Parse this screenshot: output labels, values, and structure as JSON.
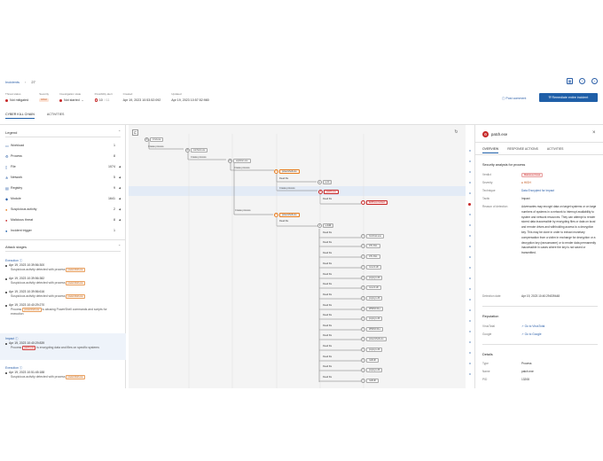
{
  "header": {
    "breadcrumb_root": "Incidents",
    "breadcrumb_id": "27",
    "status_label": "Threat status",
    "status_value": "Not mitigated",
    "severity_label": "Severity",
    "severity_value": "HIGH",
    "investigation_label": "Investigation state",
    "investigation_value": "Not started",
    "possibility_label": "Possibility alert",
    "possibility_value": "10",
    "possibility_total": "/ 11",
    "created_label": "Created",
    "created_value": "Apr 19, 2023 10:53:52:092",
    "updated_label": "Updated",
    "updated_value": "Apr 19, 2023 10:57:52:980",
    "post_comment": "Post comment",
    "remediate": "Remediate entire incident"
  },
  "tabs": [
    "CYBER KILL CHAIN",
    "ACTIVITIES"
  ],
  "legend": {
    "title": "Legend",
    "items": [
      {
        "name": "Workload",
        "count": "1",
        "icon": "workload-icon",
        "arrow": ""
      },
      {
        "name": "Process",
        "count": "8",
        "icon": "process-icon",
        "arrow": ""
      },
      {
        "name": "File",
        "count": "1074",
        "icon": "file-icon",
        "arrow": "◀"
      },
      {
        "name": "Network",
        "count": "5",
        "icon": "network-icon",
        "arrow": "◀"
      },
      {
        "name": "Registry",
        "count": "9",
        "icon": "registry-icon",
        "arrow": "◀"
      },
      {
        "name": "Module",
        "count": "1641",
        "icon": "module-icon",
        "arrow": "◀"
      },
      {
        "name": "Suspicious activity",
        "count": "2",
        "icon": "suspicious-icon",
        "arrow": "◀"
      },
      {
        "name": "Malicious threat",
        "count": "8",
        "icon": "malicious-icon",
        "arrow": "◀"
      },
      {
        "name": "Incident trigger",
        "count": "1",
        "icon": "trigger-icon",
        "arrow": ""
      }
    ]
  },
  "attack": {
    "title": "Attack stages",
    "stages": [
      {
        "name": "Execution",
        "items": [
          {
            "ts": "Apr 19, 2023 10:39:56:300",
            "desc": "Suspicious activity detected with process",
            "tag": "powershell.exe"
          },
          {
            "ts": "Apr 19, 2023 10:39:56:382",
            "desc": "Suspicious activity detected with process",
            "tag": "powershell.exe"
          },
          {
            "ts": "Apr 19, 2023 10:39:56:616",
            "desc": "Suspicious activity detected with process",
            "tag": "powershell.exe"
          },
          {
            "ts": "Apr 19, 2023 10:40:29:270",
            "desc_a": "Process",
            "tag": "powershell.exe",
            "desc_b": "is abusing PowerShell commands and scripts for execution"
          }
        ]
      },
      {
        "name": "Impact",
        "items": [
          {
            "ts": "Apr 19, 2023 10:40:29:839",
            "desc_a": "Process",
            "tag": "patch.exe",
            "desc_b": "is encrypting data and files on specific systems"
          }
        ]
      },
      {
        "name": "Execution",
        "items": [
          {
            "ts": "Apr 19, 2023 10:51:45:188",
            "desc": "Suspicious activity detected with process",
            "tag": "powershell.exe"
          }
        ]
      }
    ]
  },
  "graph": {
    "nodes": {
      "n1": "cmd.exe",
      "n2": "conhost.exe",
      "n3": "explorer.exe",
      "n4": "powershell.exe",
      "n5": "+ 4",
      "n6": "patch.exe",
      "n7": "EMP.exe.locked",
      "n8": "powershell.exe",
      "n9": "+ 110"
    },
    "edges": {
      "create_process": "Create process",
      "read_file": "Read file"
    },
    "files": [
      "Conhost.exe",
      "ATL.DLL",
      "ATL.DLL",
      "msvcrt.dll",
      "propsys.dll",
      "msvcrt.dll",
      "propsys.dll",
      "WMI32.DLL",
      "propsys.dll",
      "WMI32.DLL",
      "powershell.exe",
      "propsys.dll",
      "ntdll.dll",
      "propsys.dll",
      "ntdll.dll"
    ]
  },
  "detail": {
    "title": "patch.exe",
    "tabs": [
      "OVERVIEW",
      "RESPONSE ACTIONS",
      "ACTIVITIES"
    ],
    "security_title": "Security analysis for process",
    "verdict_label": "Verdict",
    "verdict_value": "Malicious threat",
    "severity_label": "Severity",
    "severity_value": "HIGH",
    "technique_label": "Technique",
    "technique_value": "Data Encrypted for Impact",
    "tactic_label": "Tactic",
    "tactic_value": "Impact",
    "reason_label": "Reason of detection",
    "reason_value": "Adversaries may encrypt data on target systems or on large numbers of systems in a network to interrupt availability to system and network resources. They can attempt to render stored data inaccessible by encrypting files or data on local and remote drives and withholding access to a decryption key. This may be done in order to extract monetary compensation from a victim in exchange for decryption or a decryption key (ransomware) or to render data permanently inaccessible in cases where the key is not saved or transmitted.",
    "detection_label": "Detection date",
    "detection_value": "Apr 19, 2023 10:40:29:839448",
    "reputation_title": "Reputation",
    "virustotal_label": "VirusTotal",
    "virustotal_value": "Go to VirusTotal",
    "google_label": "Google",
    "google_value": "Go to Google",
    "details_title": "Details",
    "type_label": "Type",
    "type_value": "Process",
    "name_label": "Name",
    "name_value": "patch.exe",
    "pid_label": "PID",
    "pid_value": "13208"
  },
  "colors": {
    "accent": "#1f5fa8",
    "danger": "#c62828",
    "warning": "#e67e22"
  }
}
